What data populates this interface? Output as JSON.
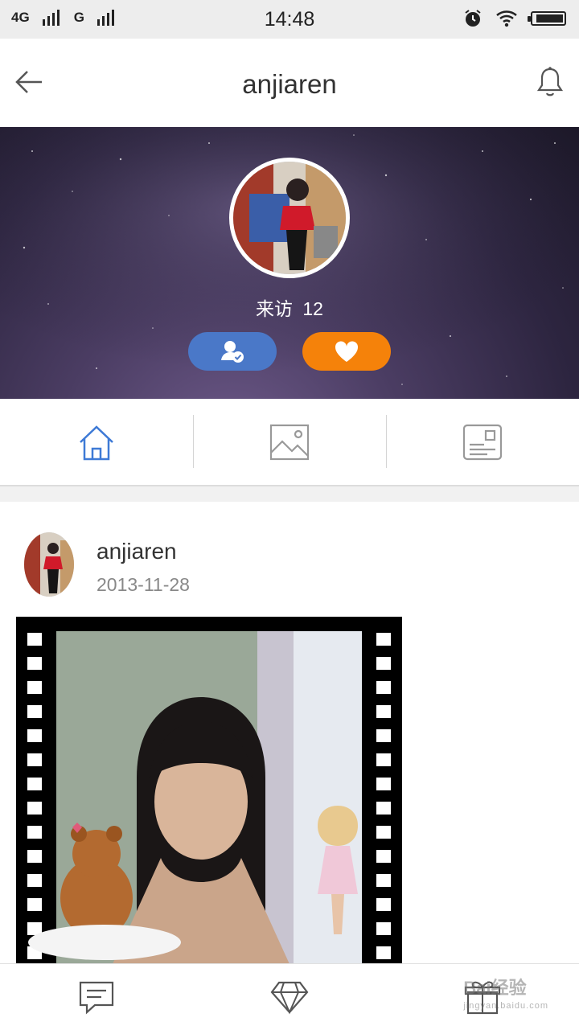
{
  "status_bar": {
    "network_1": "4G",
    "network_2": "G",
    "time": "14:48",
    "icons": [
      "alarm-icon",
      "wifi-icon",
      "battery-icon"
    ]
  },
  "header": {
    "title": "anjiaren",
    "back_icon": "arrow-left-icon",
    "bell_icon": "bell-icon"
  },
  "profile": {
    "visits_label": "来访",
    "visits_count": "12",
    "follow_icon": "user-check-icon",
    "like_icon": "heart-icon",
    "colors": {
      "follow": "#4a78c8",
      "like": "#f5820a"
    }
  },
  "tabs": [
    {
      "icon": "home-icon",
      "active": true
    },
    {
      "icon": "image-icon",
      "active": false
    },
    {
      "icon": "profile-card-icon",
      "active": false
    }
  ],
  "post": {
    "author": "anjiaren",
    "date": "2013-11-28"
  },
  "bottom_bar": {
    "icons": [
      "comment-icon",
      "diamond-icon",
      "gift-icon"
    ]
  },
  "watermark": {
    "text": "Bai经验",
    "sub": "jingyan.baidu.com"
  }
}
